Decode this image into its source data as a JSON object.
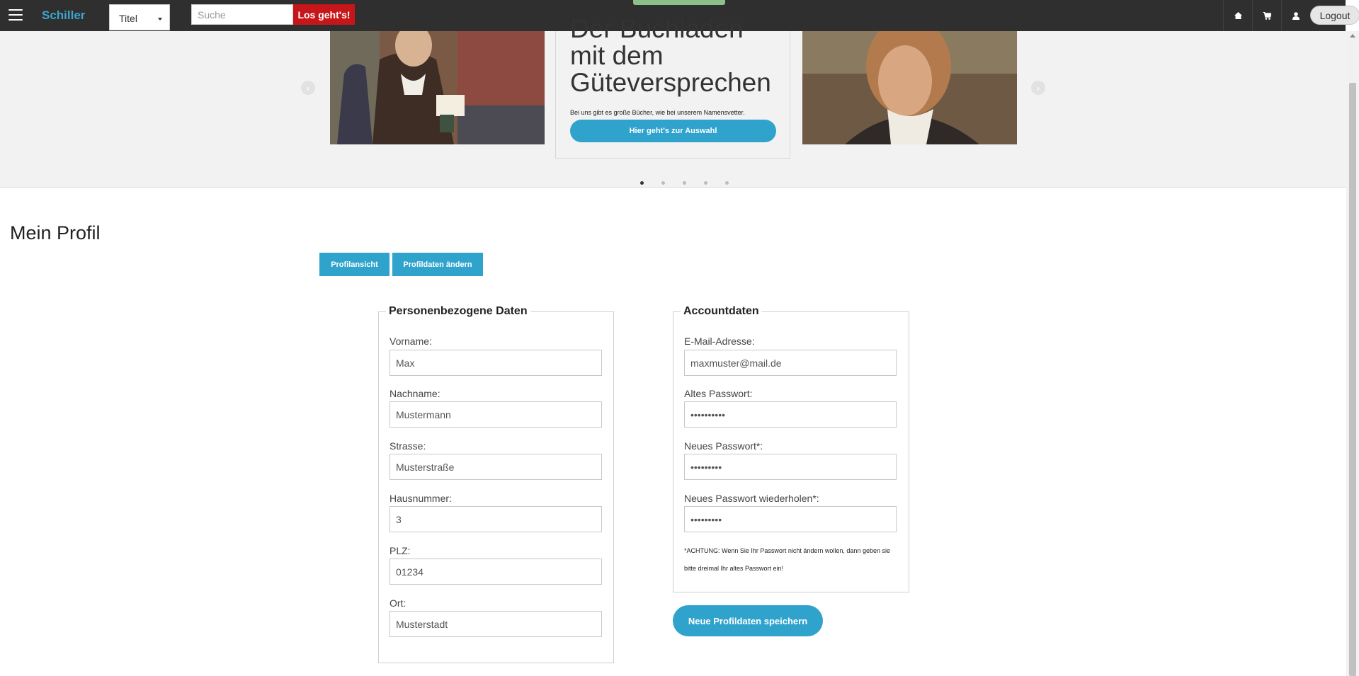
{
  "header": {
    "brand": "Schiller",
    "filter_select_value": "Titel",
    "search_placeholder": "Suche",
    "search_button": "Los geht's!",
    "logout": "Logout",
    "icons": [
      "home-icon",
      "cart-icon",
      "user-icon"
    ]
  },
  "carousel": {
    "caption_title": "Der Buchladen mit dem Güteversprechen",
    "caption_text": "Bei uns gibt es große Bücher, wie bei unserem Namensvetter.",
    "caption_button": "Hier geht's zur Auswahl",
    "prev_arrow": "‹",
    "next_arrow": "›",
    "slide_count": 5,
    "active_slide": 1
  },
  "profile": {
    "page_title": "Mein Profil",
    "tabs": [
      "Profilansicht",
      "Profildaten ändern"
    ]
  },
  "personal": {
    "legend": "Personenbezogene Daten",
    "fields": [
      {
        "label": "Vorname:",
        "value": "Max"
      },
      {
        "label": "Nachname:",
        "value": "Mustermann"
      },
      {
        "label": "Strasse:",
        "value": "Musterstraße"
      },
      {
        "label": "Hausnummer:",
        "value": "3"
      },
      {
        "label": "PLZ:",
        "value": "01234"
      },
      {
        "label": "Ort:",
        "value": "Musterstadt"
      }
    ]
  },
  "account": {
    "legend": "Accountdaten",
    "fields": [
      {
        "label": "E-Mail-Adresse:",
        "value": "maxmuster@mail.de"
      },
      {
        "label": "Altes Passwort:",
        "value": "••••••••••"
      },
      {
        "label": "Neues Passwort*:",
        "value": "•••••••••"
      },
      {
        "label": "Neues Passwort wiederholen*:",
        "value": "•••••••••"
      }
    ],
    "note": "*ACHTUNG: Wenn Sie Ihr Passwort nicht ändern wollen, dann geben sie bitte dreimal Ihr altes Passwort ein!",
    "save_button": "Neue Profildaten speichern"
  }
}
